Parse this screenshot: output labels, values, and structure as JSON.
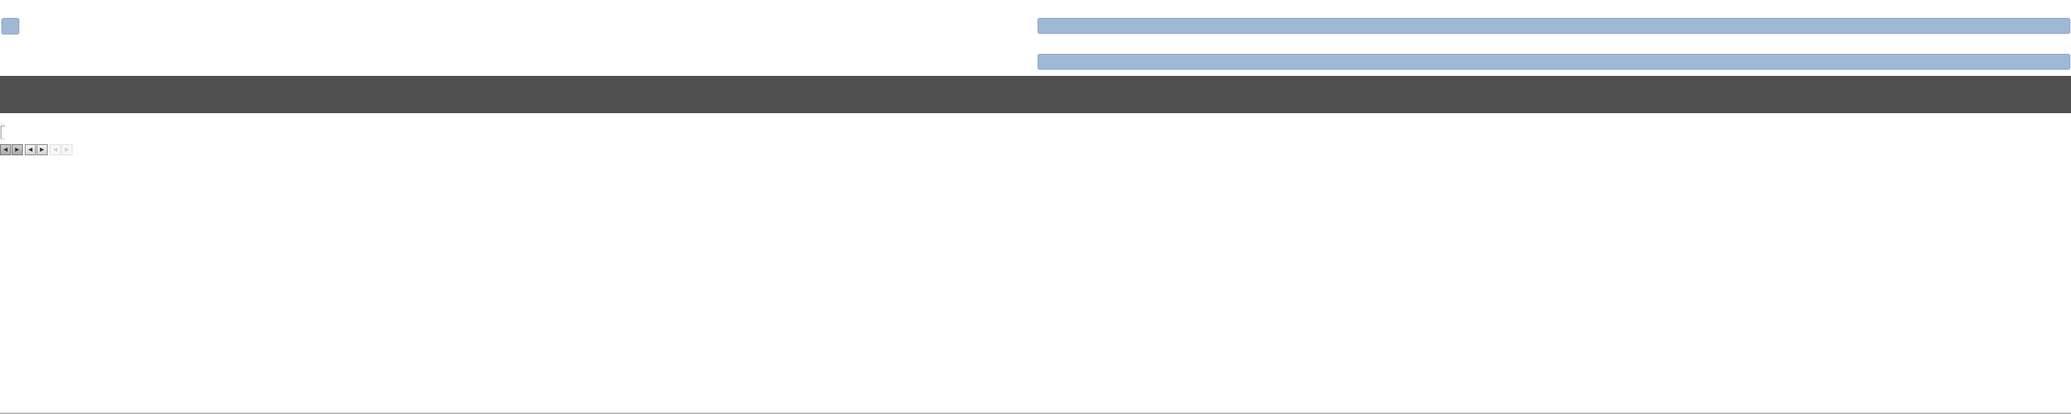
{
  "top": {
    "logo_icon": "logo-block",
    "bar_color": "#9eb8d5"
  },
  "nav_band": {
    "color": "#505050"
  },
  "content": {
    "small_label": "—"
  },
  "pager": {
    "buttons": [
      {
        "icon": "first-page-icon",
        "glyph": "◀"
      },
      {
        "icon": "previous-page-icon",
        "glyph": "▶"
      },
      {
        "icon": "previous-icon",
        "glyph": "◀"
      },
      {
        "icon": "next-icon",
        "glyph": "▶"
      },
      {
        "icon": "next-page-icon",
        "glyph": "◀"
      },
      {
        "icon": "last-page-icon",
        "glyph": "▶"
      }
    ]
  }
}
